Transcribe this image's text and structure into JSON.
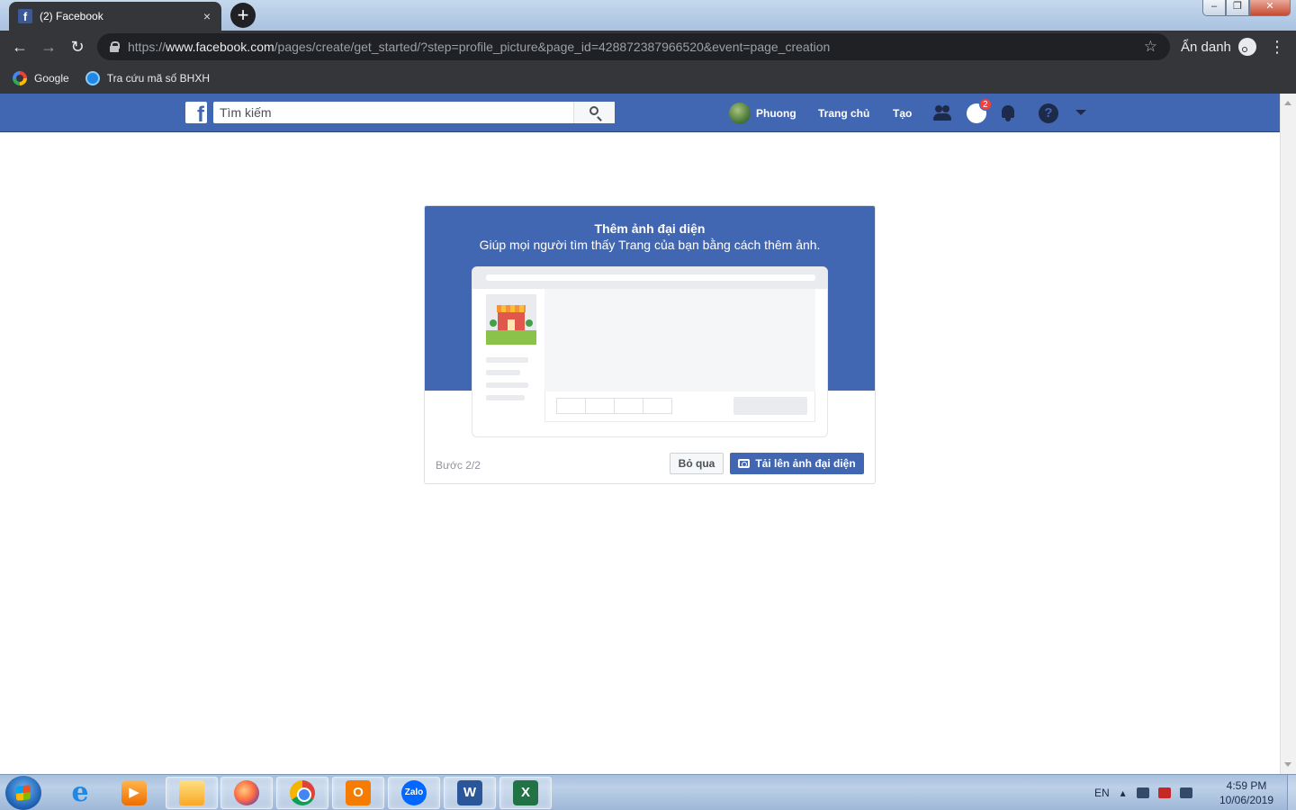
{
  "browser": {
    "tab_title": "(2) Facebook",
    "tab_close": "×",
    "new_tab": "+",
    "url_prefix": "https://",
    "url_host": "www.facebook.com",
    "url_path": "/pages/create/get_started/?step=profile_picture&page_id=428872387966520&event=page_creation",
    "incognito_label": "Ẩn danh",
    "back": "←",
    "forward": "→",
    "reload": "↻",
    "star": "☆",
    "menu": "⋮",
    "window_controls": {
      "minimize": "–",
      "maximize": "❐",
      "close": "✕"
    }
  },
  "bookmarks": [
    {
      "label": "Google",
      "icon": "google-icon"
    },
    {
      "label": "Tra cứu mã số BHXH",
      "icon": "bhxh-icon"
    }
  ],
  "facebook": {
    "logo": "f",
    "search_placeholder": "Tìm kiếm",
    "nav": {
      "profile_name": "Phuong",
      "home": "Trang chủ",
      "create": "Tạo",
      "messages_badge": "2",
      "help": "?"
    },
    "brand_color": "#4267b2"
  },
  "dialog": {
    "title": "Thêm ảnh đại diện",
    "subtitle": "Giúp mọi người tìm thấy Trang của bạn bằng cách thêm ảnh.",
    "step": "Bước 2/2",
    "skip_label": "Bỏ qua",
    "upload_label": "Tải lên ảnh đại diện"
  },
  "taskbar": {
    "apps": [
      {
        "name": "ie",
        "glyph": "e"
      },
      {
        "name": "media-player",
        "glyph": "▶"
      },
      {
        "name": "file-explorer",
        "glyph": ""
      },
      {
        "name": "firefox",
        "glyph": ""
      },
      {
        "name": "chrome",
        "glyph": ""
      },
      {
        "name": "outlook",
        "glyph": "O"
      },
      {
        "name": "zalo",
        "glyph": "Zalo"
      },
      {
        "name": "word",
        "glyph": "W"
      },
      {
        "name": "excel",
        "glyph": "X"
      }
    ],
    "language": "EN",
    "time": "4:59 PM",
    "date": "10/06/2019"
  }
}
